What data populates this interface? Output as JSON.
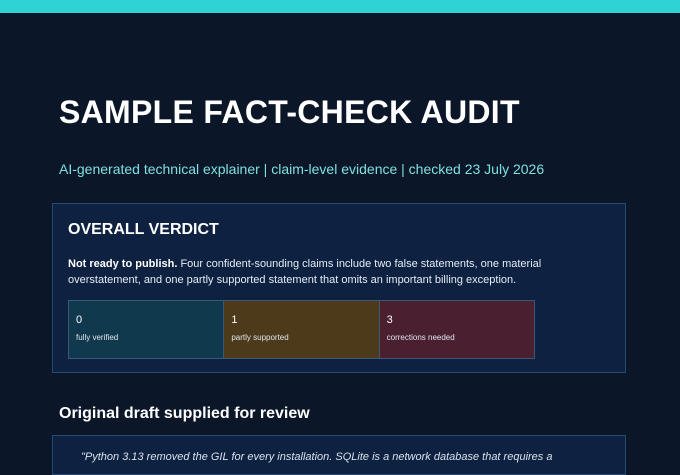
{
  "header": {
    "title": "SAMPLE FACT-CHECK AUDIT",
    "subtitle": "AI-generated technical explainer | claim-level evidence | checked 23 July 2026",
    "accent_color": "#2ed3d3"
  },
  "verdict": {
    "heading": "OVERALL VERDICT",
    "lead": "Not ready to publish.",
    "summary": " Four confident-sounding claims include two false statements, one material overstatement, and one partly supported statement that omits an important billing exception.",
    "stats": [
      {
        "value": "0",
        "label": "fully verified",
        "color": "#11394e"
      },
      {
        "value": "1",
        "label": "partly supported",
        "color": "#4c3a1b"
      },
      {
        "value": "3",
        "label": "corrections needed",
        "color": "#4a2030"
      }
    ]
  },
  "draft": {
    "heading": "Original draft supplied for review",
    "excerpt": "\"Python 3.13 removed the GIL for every installation. SQLite is a network database that requires a"
  }
}
